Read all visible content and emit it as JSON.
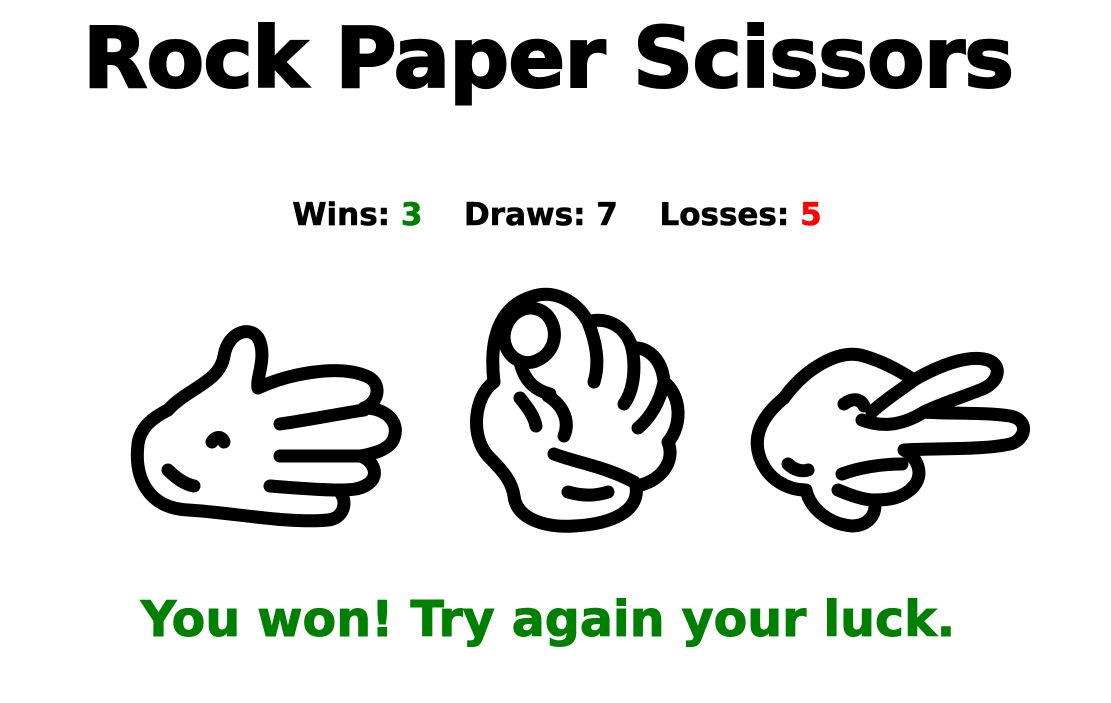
{
  "title": "Rock Paper Scissors",
  "score": {
    "wins_label": "Wins:",
    "wins": "3",
    "draws_label": "Draws:",
    "draws": "7",
    "losses_label": "Losses:",
    "losses": "5"
  },
  "choices": [
    {
      "name": "paper",
      "icon": "paper-hand-icon"
    },
    {
      "name": "rock",
      "icon": "rock-fist-icon"
    },
    {
      "name": "scissors",
      "icon": "scissors-hand-icon"
    }
  ],
  "result": "You won! Try again your luck.",
  "colors": {
    "text": "#000000",
    "win": "#008000",
    "loss": "#ff0000",
    "background": "#ffffff"
  }
}
